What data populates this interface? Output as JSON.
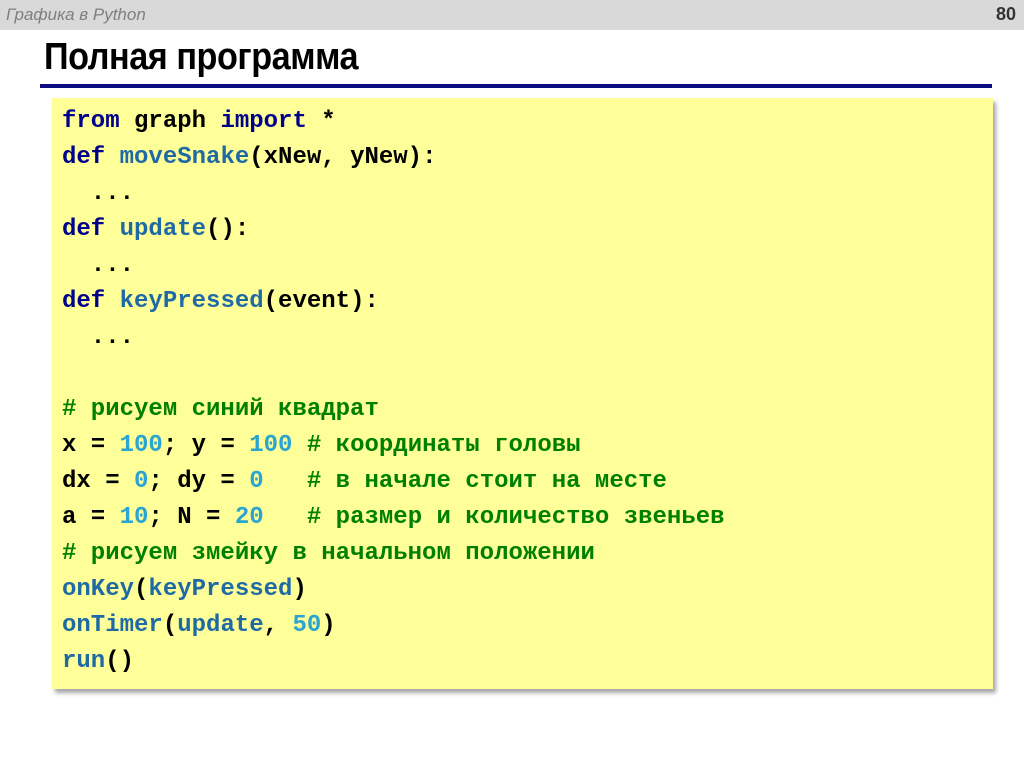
{
  "header": {
    "topic": "Графика в Python",
    "page_number": "80"
  },
  "slide": {
    "title": "Полная программа"
  },
  "colors": {
    "keyword": "#00008b",
    "function": "#1f6aa5",
    "number": "#2aa4d0",
    "comment": "#008000",
    "code_background": "#ffff99",
    "title_rule": "#0d0d80"
  },
  "code_lines": [
    [
      [
        "kw",
        "from"
      ],
      [
        "tx",
        " graph "
      ],
      [
        "kw",
        "import"
      ],
      [
        "tx",
        " *"
      ]
    ],
    [
      [
        "kw",
        "def"
      ],
      [
        "tx",
        " "
      ],
      [
        "fn",
        "moveSnake"
      ],
      [
        "tx",
        "(xNew, yNew):"
      ]
    ],
    [
      [
        "tx",
        "  ..."
      ]
    ],
    [
      [
        "kw",
        "def"
      ],
      [
        "tx",
        " "
      ],
      [
        "fn",
        "update"
      ],
      [
        "tx",
        "():"
      ]
    ],
    [
      [
        "tx",
        "  ..."
      ]
    ],
    [
      [
        "kw",
        "def"
      ],
      [
        "tx",
        " "
      ],
      [
        "fn",
        "keyPressed"
      ],
      [
        "tx",
        "(event):"
      ]
    ],
    [
      [
        "tx",
        "  ..."
      ]
    ],
    [],
    [
      [
        "cm",
        "# рисуем синий квадрат"
      ]
    ],
    [
      [
        "tx",
        "x = "
      ],
      [
        "num",
        "100"
      ],
      [
        "tx",
        "; y = "
      ],
      [
        "num",
        "100"
      ],
      [
        "tx",
        " "
      ],
      [
        "cm",
        "# координаты головы"
      ]
    ],
    [
      [
        "tx",
        "dx = "
      ],
      [
        "num",
        "0"
      ],
      [
        "tx",
        "; dy = "
      ],
      [
        "num",
        "0"
      ],
      [
        "tx",
        "   "
      ],
      [
        "cm",
        "# в начале стоит на месте"
      ]
    ],
    [
      [
        "tx",
        "a = "
      ],
      [
        "num",
        "10"
      ],
      [
        "tx",
        "; N = "
      ],
      [
        "num",
        "20"
      ],
      [
        "tx",
        "   "
      ],
      [
        "cm",
        "# размер и количество звеньев"
      ]
    ],
    [
      [
        "cm",
        "# рисуем змейку в начальном положении"
      ]
    ],
    [
      [
        "fn",
        "onKey"
      ],
      [
        "tx",
        "("
      ],
      [
        "fn",
        "keyPressed"
      ],
      [
        "tx",
        ")"
      ]
    ],
    [
      [
        "fn",
        "onTimer"
      ],
      [
        "tx",
        "("
      ],
      [
        "fn",
        "update"
      ],
      [
        "tx",
        ", "
      ],
      [
        "num",
        "50"
      ],
      [
        "tx",
        ")"
      ]
    ],
    [
      [
        "fn",
        "run"
      ],
      [
        "tx",
        "()"
      ]
    ]
  ]
}
